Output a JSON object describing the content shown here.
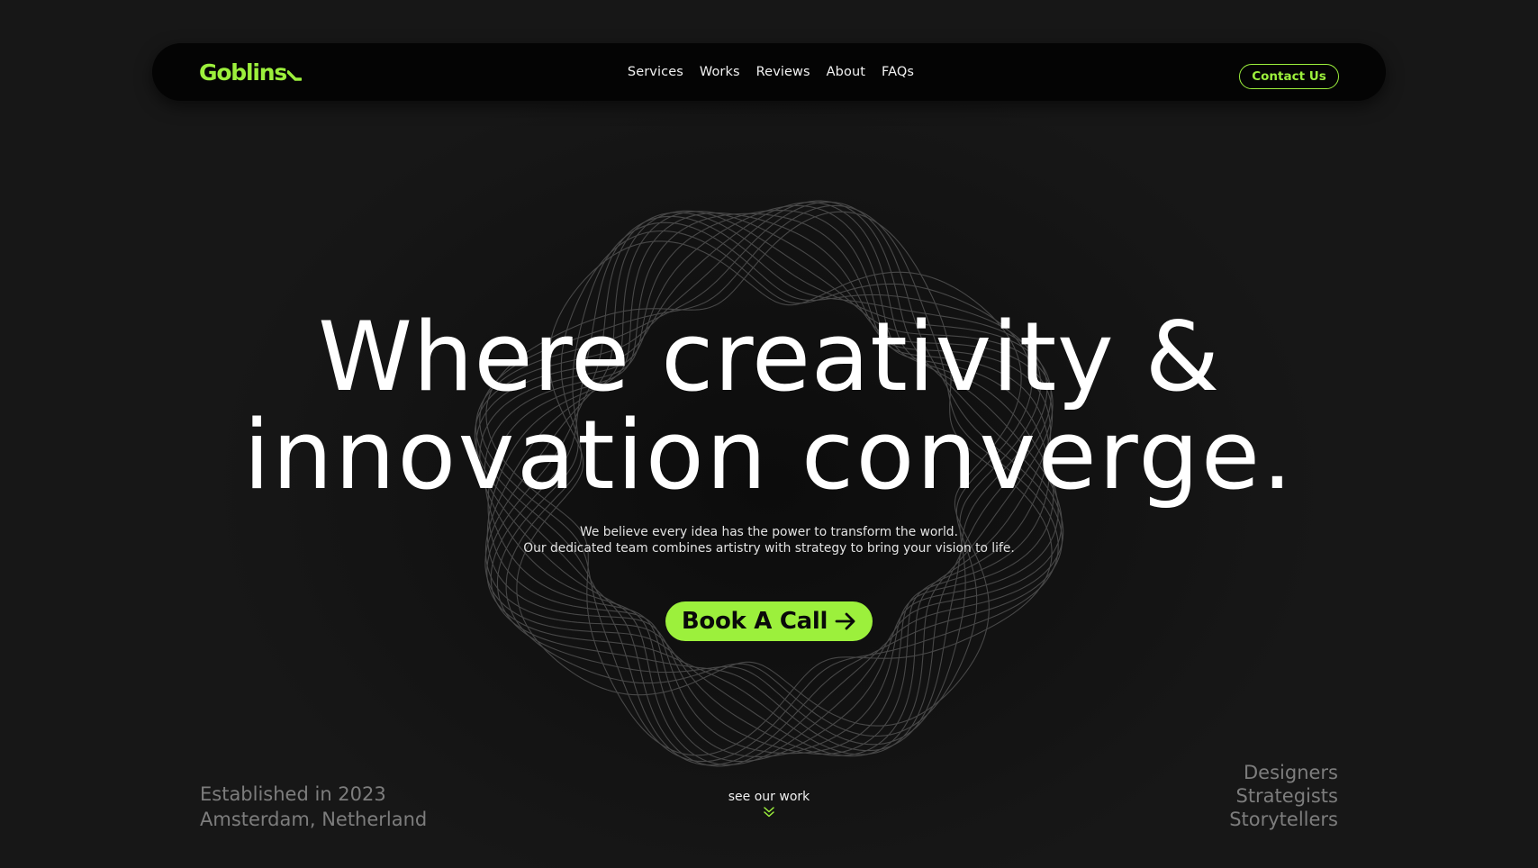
{
  "brand": {
    "name": "Goblins",
    "accent": "#9cf03c"
  },
  "nav": {
    "items": [
      "Services",
      "Works",
      "Reviews",
      "About",
      "FAQs"
    ],
    "contact_label": "Contact Us"
  },
  "hero": {
    "headline_line1": "Where creativity &",
    "headline_line2": "innovation converge.",
    "sub_line1": "We believe every idea has the power to transform the world.",
    "sub_line2": "Our dedicated team combines artistry with strategy to bring your vision to life.",
    "cta_label": "Book A Call"
  },
  "footer": {
    "established": "Established in 2023",
    "location": "Amsterdam, Netherland",
    "see_work": "see our work",
    "roles": [
      "Designers",
      "Strategists",
      "Storytellers"
    ]
  },
  "icons": {
    "cta": "arrow-right-icon",
    "scroll": "double-chevron-down-icon",
    "decor": "spirograph-rings"
  }
}
